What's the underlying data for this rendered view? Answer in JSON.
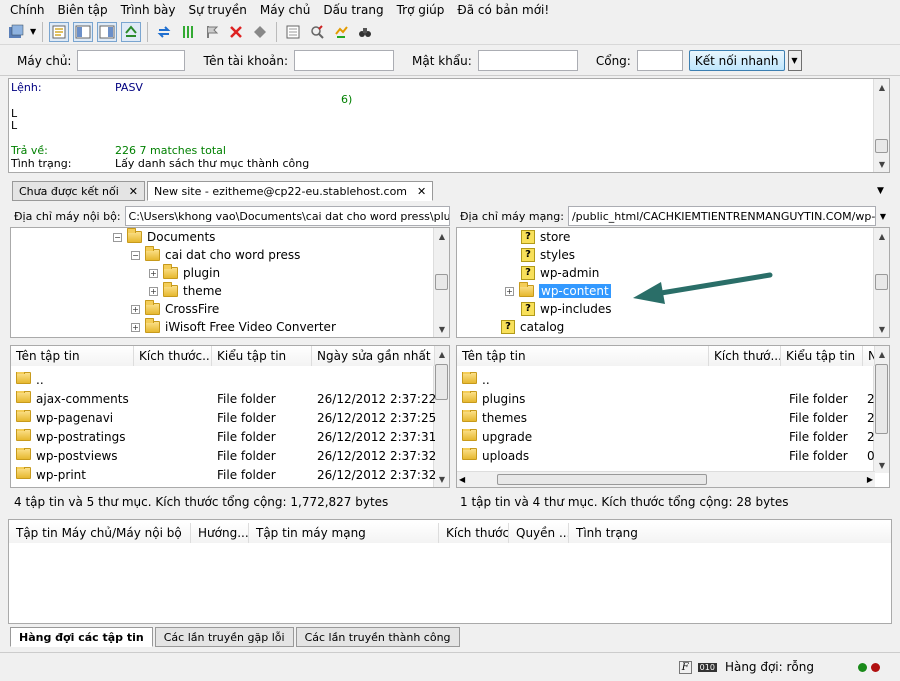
{
  "menu": [
    "Chính",
    "Biên tập",
    "Trình bày",
    "Sự truyền",
    "Máy chủ",
    "Dấu trang",
    "Trợ giúp",
    "Đã có bản mới!"
  ],
  "toolbar_icons": [
    "site-manager-icon",
    "toggle-log-icon",
    "toggle-local-tree-icon",
    "toggle-remote-tree-icon",
    "toggle-queue-icon",
    "refresh-icon",
    "process-queue-icon",
    "cancel-icon",
    "stop-icon",
    "disconnect-icon",
    "filter-icon",
    "compare-icon",
    "sync-browse-icon",
    "find-icon"
  ],
  "quickconnect": {
    "host_label": "Máy chủ:",
    "user_label": "Tên tài khoản:",
    "pass_label": "Mật khẩu:",
    "port_label": "Cổng:",
    "connect_label": "Kết nối nhanh",
    "host_value": "",
    "user_value": "",
    "pass_value": "",
    "port_value": ""
  },
  "log": {
    "lines": [
      {
        "label": "Lệnh:",
        "text": "PASV",
        "color": "#000080"
      },
      {
        "label": "",
        "text": "6)",
        "color": "#008000"
      },
      {
        "label": "L",
        "text": "",
        "color": "#000000"
      },
      {
        "label": "L",
        "text": "",
        "color": "#000000"
      },
      {
        "label": "Trả về:",
        "text": "226 7 matches total",
        "color": "#008000"
      },
      {
        "label": "Tình trạng:",
        "text": "Lấy danh sách thư mục thành công",
        "color": "#000000"
      }
    ]
  },
  "tabs": [
    {
      "label": "Chưa được kết nối",
      "close": "✕"
    },
    {
      "label": "New site - ezitheme@cp22-eu.stablehost.com",
      "close": "✕"
    }
  ],
  "local": {
    "addr_label": "Địa chỉ máy nội bộ:",
    "addr_value": "C:\\Users\\khong vao\\Documents\\cai dat cho word press\\plugin\\",
    "tree": [
      {
        "name": "Documents",
        "indent": 0,
        "exp": "−"
      },
      {
        "name": "cai dat cho word press",
        "indent": 1,
        "exp": "−"
      },
      {
        "name": "plugin",
        "indent": 2,
        "exp": "+"
      },
      {
        "name": "theme",
        "indent": 2,
        "exp": "+"
      },
      {
        "name": "CrossFire",
        "indent": 1,
        "exp": "+"
      },
      {
        "name": "iWisoft Free Video Converter",
        "indent": 1,
        "exp": "+"
      }
    ],
    "columns": [
      "Tên tập tin",
      "Kích thước...",
      "Kiểu tập tin",
      "Ngày sửa gần nhất"
    ],
    "files": [
      {
        "name": "..",
        "size": "",
        "type": "",
        "date": ""
      },
      {
        "name": "ajax-comments",
        "size": "",
        "type": "File folder",
        "date": "26/12/2012 2:37:22..."
      },
      {
        "name": "wp-pagenavi",
        "size": "",
        "type": "File folder",
        "date": "26/12/2012 2:37:25..."
      },
      {
        "name": "wp-postratings",
        "size": "",
        "type": "File folder",
        "date": "26/12/2012 2:37:31..."
      },
      {
        "name": "wp-postviews",
        "size": "",
        "type": "File folder",
        "date": "26/12/2012 2:37:32..."
      },
      {
        "name": "wp-print",
        "size": "",
        "type": "File folder",
        "date": "26/12/2012 2:37:32..."
      }
    ],
    "status": "4 tập tin và 5 thư mục. Kích thước tổng cộng: 1,772,827 bytes"
  },
  "remote": {
    "addr_label": "Địa chỉ máy mạng:",
    "addr_value": "/public_html/CACHKIEMTIENTRENMANGUYTIN.COM/wp-content",
    "tree": [
      {
        "name": "store",
        "indent": 1,
        "type": "q"
      },
      {
        "name": "styles",
        "indent": 1,
        "type": "q"
      },
      {
        "name": "wp-admin",
        "indent": 1,
        "type": "q"
      },
      {
        "name": "wp-content",
        "indent": 1,
        "type": "folder",
        "selected": true
      },
      {
        "name": "wp-includes",
        "indent": 1,
        "type": "q"
      },
      {
        "name": "catalog",
        "indent": 0,
        "type": "q"
      }
    ],
    "columns": [
      "Tên tập tin",
      "Kích thướ...",
      "Kiểu tập tin",
      "N"
    ],
    "files": [
      {
        "name": "..",
        "type": "",
        "extra": ""
      },
      {
        "name": "plugins",
        "type": "File folder",
        "extra": "2"
      },
      {
        "name": "themes",
        "type": "File folder",
        "extra": "2"
      },
      {
        "name": "upgrade",
        "type": "File folder",
        "extra": "2"
      },
      {
        "name": "uploads",
        "type": "File folder",
        "extra": "0"
      }
    ],
    "status": "1 tập tin và 4 thư mục. Kích thước tổng cộng: 28 bytes"
  },
  "queue": {
    "columns": [
      "Tập tin Máy chủ/Máy nội bộ",
      "Hướng...",
      "Tập tin máy mạng",
      "Kích thước",
      "Quyền ...",
      "Tình trạng"
    ]
  },
  "bottom_tabs": [
    "Hàng đợi các tập tin",
    "Các lần truyền gặp lỗi",
    "Các lần truyền thành công"
  ],
  "statusbar": {
    "queue_text": "Hàng đợi: rỗng"
  },
  "colors": {
    "selection": "#3399ff",
    "arrow": "#2a6e68",
    "led_green": "#1a8a1a",
    "led_red": "#b01010"
  }
}
